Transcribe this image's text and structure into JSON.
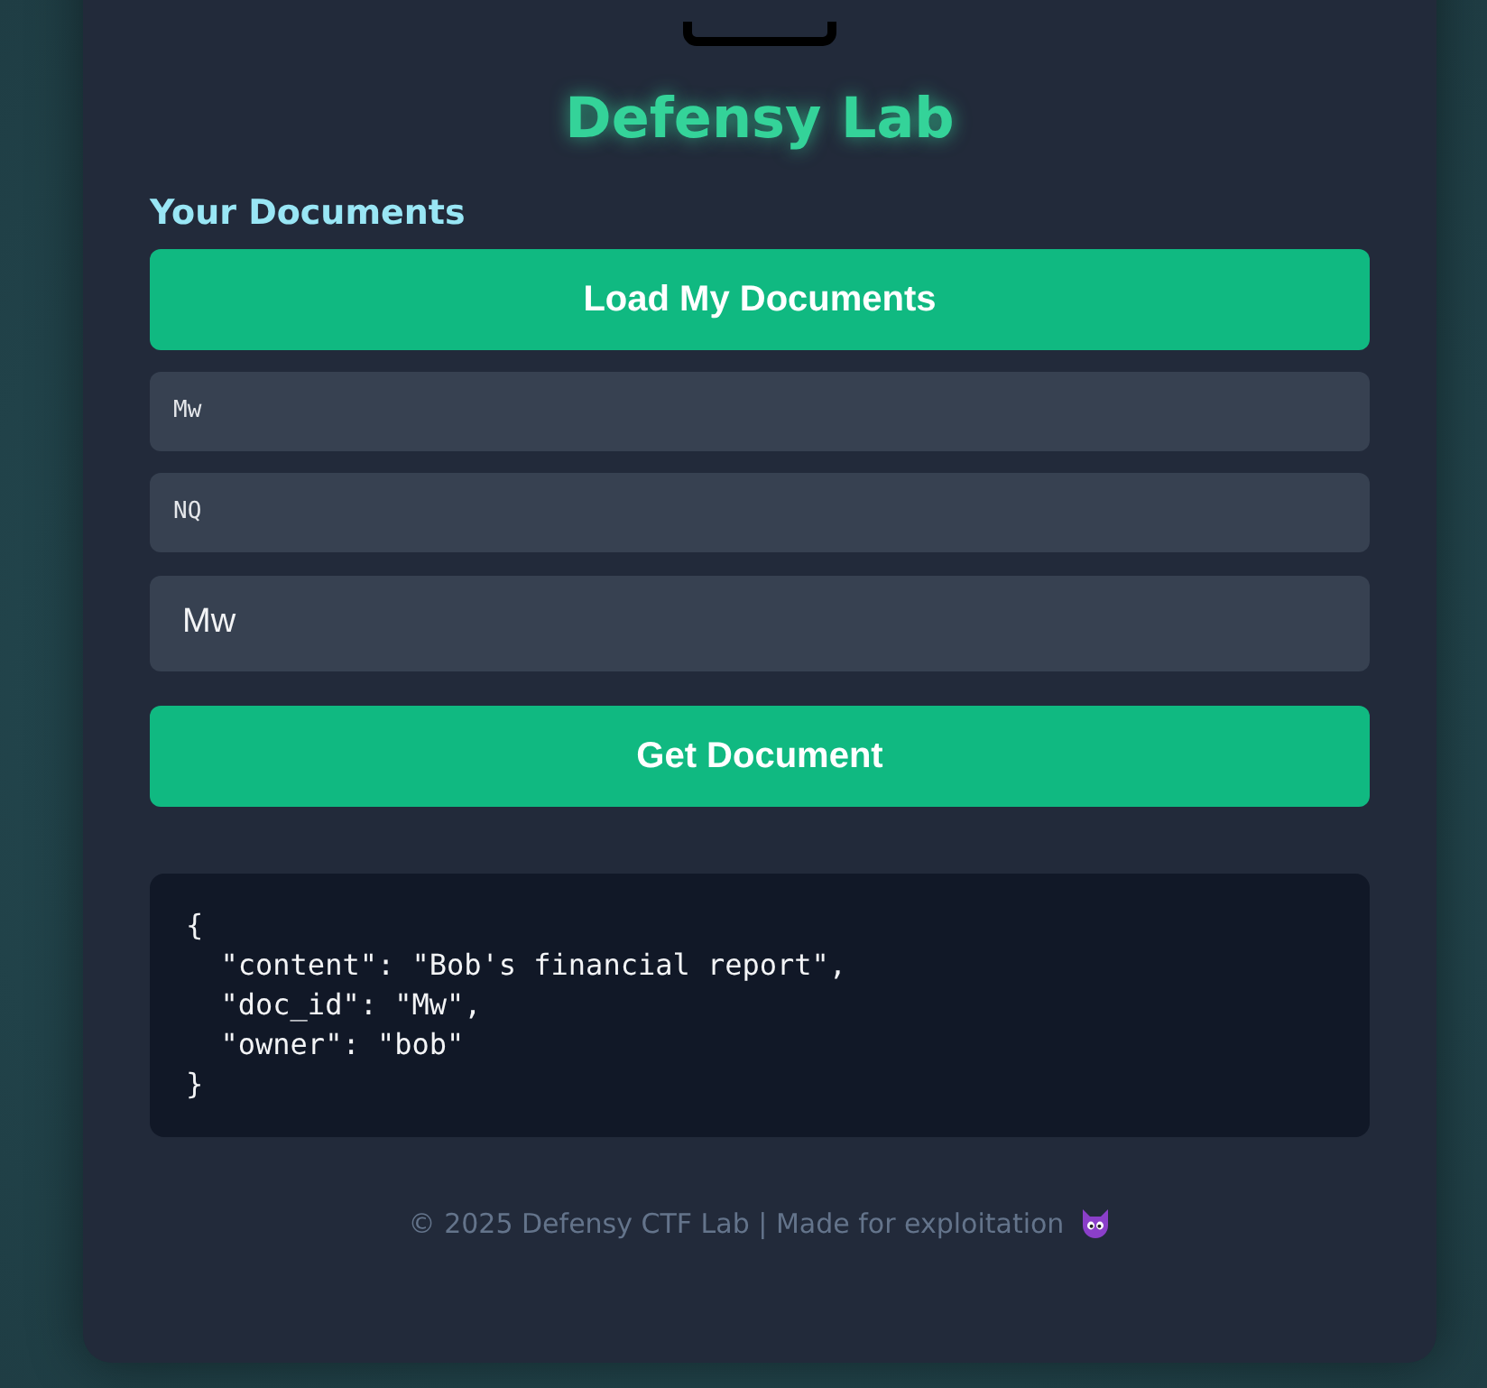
{
  "brand": {
    "title": "Defensy Lab"
  },
  "section_title": "Your Documents",
  "load_button": "Load My Documents",
  "documents": [
    {
      "doc_id": "Mw"
    },
    {
      "doc_id": "NQ"
    }
  ],
  "doc_input": {
    "value": "Mw"
  },
  "get_button": "Get Document",
  "result": "{\n  \"content\": \"Bob's financial report\",\n  \"doc_id\": \"Mw\",\n  \"owner\": \"bob\"\n}",
  "footer": "© 2025 Defensy CTF Lab | Made for exploitation"
}
